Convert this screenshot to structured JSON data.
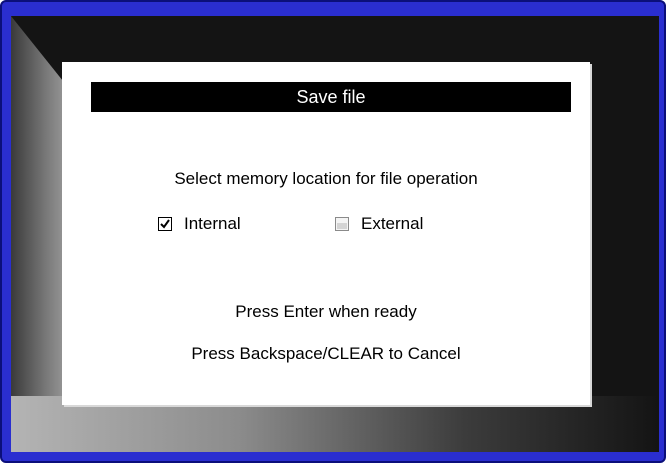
{
  "dialog": {
    "title": "Save file",
    "prompt": "Select memory location for file operation",
    "options": [
      {
        "label": "Internal",
        "checked": true
      },
      {
        "label": "External",
        "checked": false
      }
    ],
    "instructions": [
      "Press Enter when ready",
      "Press Backspace/CLEAR to Cancel"
    ]
  },
  "colors": {
    "frame": "#2a2ed0",
    "screen": "#141414",
    "title_bar": "#000000",
    "dialog_bg": "#ffffff"
  }
}
